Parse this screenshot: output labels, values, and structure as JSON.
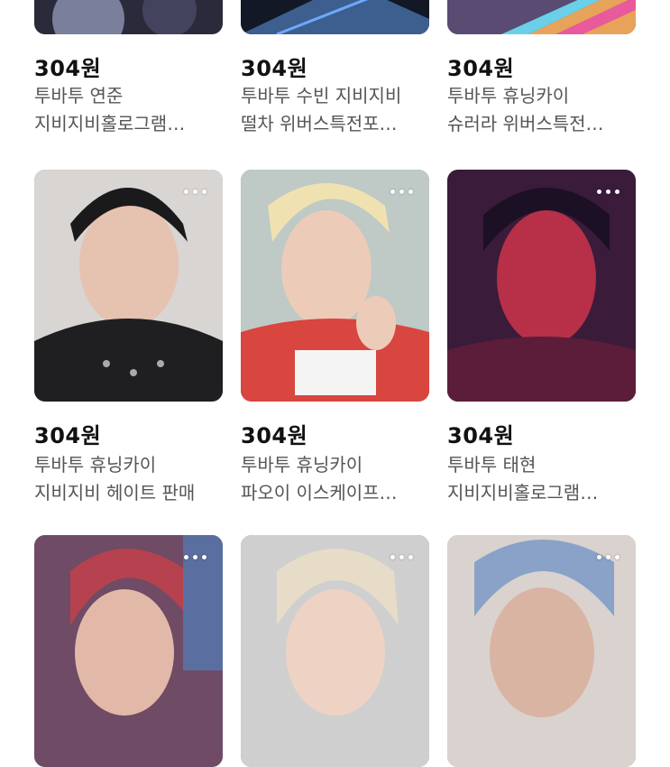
{
  "rows": [
    {
      "items": [
        {
          "price": "304원",
          "line1": "투바투 연준",
          "line2": "지비지비홀로그램…",
          "colors": {
            "a": "#2b2a3a",
            "b": "#7a7f9c"
          }
        },
        {
          "price": "304원",
          "line1": "투바투 수빈 지비지비",
          "line2": "떨차 위버스특전포…",
          "colors": {
            "a": "#121826",
            "b": "#3d5f8f"
          }
        },
        {
          "price": "304원",
          "line1": "투바투 휴닝카이",
          "line2": "슈러라 위버스특전…",
          "colors": {
            "a": "#5a4b73",
            "b": "#e8a35a"
          }
        }
      ]
    },
    {
      "items": [
        {
          "price": "304원",
          "line1": "투바투 휴닝카이",
          "line2": "지비지비 헤이트 판매",
          "colors": {
            "a": "#d8d5d3",
            "b": "#1f1f22"
          }
        },
        {
          "price": "304원",
          "line1": "투바투 휴닝카이",
          "line2": "파오이 이스케이프…",
          "colors": {
            "a": "#bfc9c6",
            "b": "#d9453f"
          }
        },
        {
          "price": "304원",
          "line1": "투바투 태현",
          "line2": "지비지비홀로그램…",
          "colors": {
            "a": "#3a1b3a",
            "b": "#b73048"
          }
        }
      ]
    },
    {
      "items": [
        {
          "colors": {
            "a": "#6f4b66",
            "b": "#b5424e"
          }
        },
        {
          "colors": {
            "a": "#cfcfcf",
            "b": "#e6dcc8"
          }
        },
        {
          "colors": {
            "a": "#8aa2c8",
            "b": "#d9b4a2"
          }
        }
      ]
    }
  ]
}
